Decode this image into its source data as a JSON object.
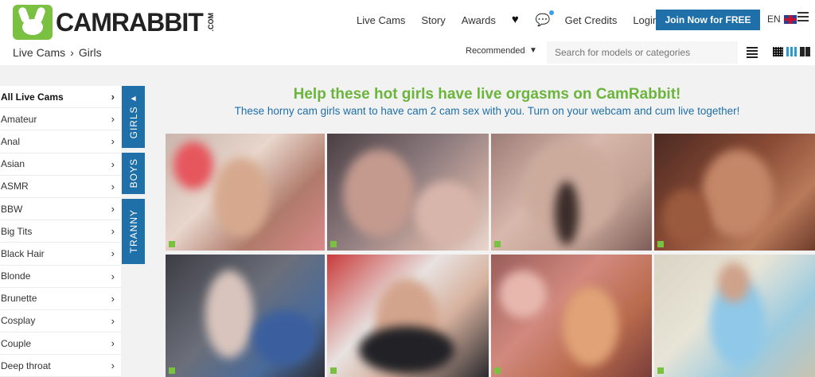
{
  "header": {
    "logo_text": "CAMRABBIT",
    "logo_suffix": ".COM",
    "nav": [
      "Live Cams",
      "Story",
      "Awards"
    ],
    "get_credits": "Get Credits",
    "login": "Login",
    "join": "Join Now for FREE",
    "lang": "EN"
  },
  "breadcrumb": {
    "root": "Live Cams",
    "current": "Girls"
  },
  "toolbar": {
    "sort": "Recommended",
    "search_placeholder": "Search for models or categories"
  },
  "sidebar": {
    "items": [
      "All Live Cams",
      "Amateur",
      "Anal",
      "Asian",
      "ASMR",
      "BBW",
      "Big Tits",
      "Black Hair",
      "Blonde",
      "Brunette",
      "Cosplay",
      "Couple",
      "Deep throat"
    ]
  },
  "tabs": [
    "GIRLS",
    "BOYS",
    "TRANNY"
  ],
  "main": {
    "headline": "Help these hot girls have live orgasms on CamRabbit!",
    "subline": "These horny cam girls want to have cam 2 cam sex with you. Turn on your webcam and cum live together!"
  },
  "colors": {
    "brand_green": "#7ac142",
    "brand_blue": "#1f6fa8",
    "headline_green": "#6bb53c"
  }
}
